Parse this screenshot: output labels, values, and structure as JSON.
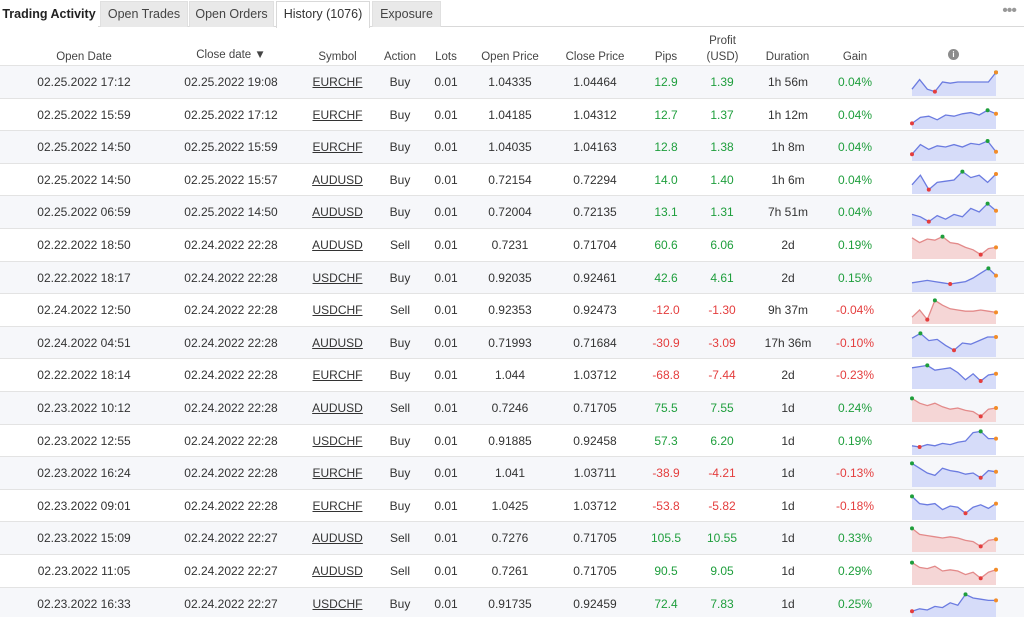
{
  "tabs": [
    {
      "label": "Trading Activity"
    },
    {
      "label": "Open Trades"
    },
    {
      "label": "Open Orders"
    },
    {
      "label": "History (1076)"
    },
    {
      "label": "Exposure"
    }
  ],
  "more_label": "•••",
  "columns": {
    "open_date": "Open Date",
    "close_date": "Close date ▼",
    "symbol": "Symbol",
    "action": "Action",
    "lots": "Lots",
    "open_price": "Open Price",
    "close_price": "Close Price",
    "pips": "Pips",
    "profit_line1": "Profit",
    "profit_line2": "(USD)",
    "duration": "Duration",
    "gain": "Gain",
    "info_icon": "i"
  },
  "colors": {
    "positive": "#1e9e3c",
    "negative": "#e43d3d",
    "spark_blue": "#6b7be0",
    "spark_red": "#e38a8a"
  },
  "rows": [
    {
      "open": "02.25.2022 17:12",
      "close": "02.25.2022 19:08",
      "symbol": "EURCHF",
      "action": "Buy",
      "lots": "0.01",
      "open_price": "1.04335",
      "close_price": "1.04464",
      "pips": "12.9",
      "profit": "1.39",
      "duration": "1h 56m",
      "gain": "0.04%",
      "positive": true
    },
    {
      "open": "02.25.2022 15:59",
      "close": "02.25.2022 17:12",
      "symbol": "EURCHF",
      "action": "Buy",
      "lots": "0.01",
      "open_price": "1.04185",
      "close_price": "1.04312",
      "pips": "12.7",
      "profit": "1.37",
      "duration": "1h 12m",
      "gain": "0.04%",
      "positive": true
    },
    {
      "open": "02.25.2022 14:50",
      "close": "02.25.2022 15:59",
      "symbol": "EURCHF",
      "action": "Buy",
      "lots": "0.01",
      "open_price": "1.04035",
      "close_price": "1.04163",
      "pips": "12.8",
      "profit": "1.38",
      "duration": "1h 8m",
      "gain": "0.04%",
      "positive": true
    },
    {
      "open": "02.25.2022 14:50",
      "close": "02.25.2022 15:57",
      "symbol": "AUDUSD",
      "action": "Buy",
      "lots": "0.01",
      "open_price": "0.72154",
      "close_price": "0.72294",
      "pips": "14.0",
      "profit": "1.40",
      "duration": "1h 6m",
      "gain": "0.04%",
      "positive": true
    },
    {
      "open": "02.25.2022 06:59",
      "close": "02.25.2022 14:50",
      "symbol": "AUDUSD",
      "action": "Buy",
      "lots": "0.01",
      "open_price": "0.72004",
      "close_price": "0.72135",
      "pips": "13.1",
      "profit": "1.31",
      "duration": "7h 51m",
      "gain": "0.04%",
      "positive": true
    },
    {
      "open": "02.22.2022 18:50",
      "close": "02.24.2022 22:28",
      "symbol": "AUDUSD",
      "action": "Sell",
      "lots": "0.01",
      "open_price": "0.7231",
      "close_price": "0.71704",
      "pips": "60.6",
      "profit": "6.06",
      "duration": "2d",
      "gain": "0.19%",
      "positive": true
    },
    {
      "open": "02.22.2022 18:17",
      "close": "02.24.2022 22:28",
      "symbol": "USDCHF",
      "action": "Buy",
      "lots": "0.01",
      "open_price": "0.92035",
      "close_price": "0.92461",
      "pips": "42.6",
      "profit": "4.61",
      "duration": "2d",
      "gain": "0.15%",
      "positive": true
    },
    {
      "open": "02.24.2022 12:50",
      "close": "02.24.2022 22:28",
      "symbol": "USDCHF",
      "action": "Sell",
      "lots": "0.01",
      "open_price": "0.92353",
      "close_price": "0.92473",
      "pips": "-12.0",
      "profit": "-1.30",
      "duration": "9h 37m",
      "gain": "-0.04%",
      "positive": false
    },
    {
      "open": "02.24.2022 04:51",
      "close": "02.24.2022 22:28",
      "symbol": "AUDUSD",
      "action": "Buy",
      "lots": "0.01",
      "open_price": "0.71993",
      "close_price": "0.71684",
      "pips": "-30.9",
      "profit": "-3.09",
      "duration": "17h 36m",
      "gain": "-0.10%",
      "positive": false
    },
    {
      "open": "02.22.2022 18:14",
      "close": "02.24.2022 22:28",
      "symbol": "EURCHF",
      "action": "Buy",
      "lots": "0.01",
      "open_price": "1.044",
      "close_price": "1.03712",
      "pips": "-68.8",
      "profit": "-7.44",
      "duration": "2d",
      "gain": "-0.23%",
      "positive": false
    },
    {
      "open": "02.23.2022 10:12",
      "close": "02.24.2022 22:28",
      "symbol": "AUDUSD",
      "action": "Sell",
      "lots": "0.01",
      "open_price": "0.7246",
      "close_price": "0.71705",
      "pips": "75.5",
      "profit": "7.55",
      "duration": "1d",
      "gain": "0.24%",
      "positive": true
    },
    {
      "open": "02.23.2022 12:55",
      "close": "02.24.2022 22:28",
      "symbol": "USDCHF",
      "action": "Buy",
      "lots": "0.01",
      "open_price": "0.91885",
      "close_price": "0.92458",
      "pips": "57.3",
      "profit": "6.20",
      "duration": "1d",
      "gain": "0.19%",
      "positive": true
    },
    {
      "open": "02.23.2022 16:24",
      "close": "02.24.2022 22:28",
      "symbol": "EURCHF",
      "action": "Buy",
      "lots": "0.01",
      "open_price": "1.041",
      "close_price": "1.03711",
      "pips": "-38.9",
      "profit": "-4.21",
      "duration": "1d",
      "gain": "-0.13%",
      "positive": false
    },
    {
      "open": "02.23.2022 09:01",
      "close": "02.24.2022 22:28",
      "symbol": "EURCHF",
      "action": "Buy",
      "lots": "0.01",
      "open_price": "1.0425",
      "close_price": "1.03712",
      "pips": "-53.8",
      "profit": "-5.82",
      "duration": "1d",
      "gain": "-0.18%",
      "positive": false
    },
    {
      "open": "02.23.2022 15:09",
      "close": "02.24.2022 22:27",
      "symbol": "AUDUSD",
      "action": "Sell",
      "lots": "0.01",
      "open_price": "0.7276",
      "close_price": "0.71705",
      "pips": "105.5",
      "profit": "10.55",
      "duration": "1d",
      "gain": "0.33%",
      "positive": true
    },
    {
      "open": "02.23.2022 11:05",
      "close": "02.24.2022 22:27",
      "symbol": "AUDUSD",
      "action": "Sell",
      "lots": "0.01",
      "open_price": "0.7261",
      "close_price": "0.71705",
      "pips": "90.5",
      "profit": "9.05",
      "duration": "1d",
      "gain": "0.29%",
      "positive": true
    },
    {
      "open": "02.23.2022 16:33",
      "close": "02.24.2022 22:27",
      "symbol": "USDCHF",
      "action": "Buy",
      "lots": "0.01",
      "open_price": "0.91735",
      "close_price": "0.92459",
      "pips": "72.4",
      "profit": "7.83",
      "duration": "1d",
      "gain": "0.25%",
      "positive": true
    }
  ],
  "sparklines": [
    {
      "color": "blue",
      "values": [
        0.2,
        0.6,
        0.2,
        0.1,
        0.5,
        0.45,
        0.5,
        0.5,
        0.5,
        0.5,
        0.5,
        0.9
      ],
      "low": 3,
      "high": 11,
      "end": 11
    },
    {
      "color": "blue",
      "values": [
        0.15,
        0.4,
        0.45,
        0.3,
        0.5,
        0.45,
        0.55,
        0.6,
        0.5,
        0.7,
        0.55
      ],
      "low": 0,
      "high": 9,
      "end": 10
    },
    {
      "color": "blue",
      "values": [
        0.2,
        0.6,
        0.4,
        0.55,
        0.5,
        0.6,
        0.5,
        0.65,
        0.6,
        0.75,
        0.3
      ],
      "low": 0,
      "high": 9,
      "end": 10
    },
    {
      "color": "blue",
      "values": [
        0.3,
        0.7,
        0.1,
        0.4,
        0.45,
        0.5,
        0.85,
        0.6,
        0.7,
        0.4,
        0.75
      ],
      "low": 2,
      "high": 6,
      "end": 10
    },
    {
      "color": "blue",
      "values": [
        0.4,
        0.3,
        0.1,
        0.35,
        0.2,
        0.4,
        0.3,
        0.65,
        0.5,
        0.85,
        0.55
      ],
      "low": 2,
      "high": 9,
      "end": 10
    },
    {
      "color": "red",
      "values": [
        0.8,
        0.6,
        0.75,
        0.7,
        0.85,
        0.6,
        0.55,
        0.4,
        0.3,
        0.1,
        0.35,
        0.4
      ],
      "low": 9,
      "high": 4,
      "end": 11
    },
    {
      "color": "blue",
      "values": [
        0.3,
        0.35,
        0.4,
        0.35,
        0.3,
        0.25,
        0.3,
        0.35,
        0.5,
        0.7,
        0.9,
        0.6
      ],
      "low": 5,
      "high": 10,
      "end": 11
    },
    {
      "color": "red",
      "values": [
        0.2,
        0.5,
        0.1,
        0.9,
        0.7,
        0.55,
        0.5,
        0.45,
        0.45,
        0.5,
        0.45,
        0.4
      ],
      "low": 2,
      "high": 3,
      "end": 11
    },
    {
      "color": "blue",
      "values": [
        0.7,
        0.9,
        0.6,
        0.65,
        0.4,
        0.2,
        0.5,
        0.45,
        0.6,
        0.75,
        0.75
      ],
      "low": 5,
      "high": 1,
      "end": 10
    },
    {
      "color": "blue",
      "values": [
        0.8,
        0.85,
        0.9,
        0.7,
        0.75,
        0.8,
        0.6,
        0.3,
        0.55,
        0.25,
        0.5,
        0.55
      ],
      "low": 9,
      "high": 2,
      "end": 11
    },
    {
      "color": "red",
      "values": [
        0.9,
        0.7,
        0.6,
        0.7,
        0.55,
        0.45,
        0.5,
        0.4,
        0.35,
        0.15,
        0.45,
        0.5
      ],
      "low": 9,
      "high": 0,
      "end": 11
    },
    {
      "color": "blue",
      "values": [
        0.3,
        0.25,
        0.35,
        0.3,
        0.4,
        0.35,
        0.45,
        0.5,
        0.85,
        0.9,
        0.6,
        0.6
      ],
      "low": 1,
      "high": 9,
      "end": 11
    },
    {
      "color": "blue",
      "values": [
        0.9,
        0.7,
        0.5,
        0.4,
        0.7,
        0.6,
        0.55,
        0.45,
        0.5,
        0.3,
        0.6,
        0.55
      ],
      "low": 9,
      "high": 0,
      "end": 11
    },
    {
      "color": "blue",
      "values": [
        0.9,
        0.6,
        0.55,
        0.6,
        0.35,
        0.5,
        0.45,
        0.2,
        0.45,
        0.55,
        0.4,
        0.6
      ],
      "low": 7,
      "high": 0,
      "end": 11
    },
    {
      "color": "red",
      "values": [
        0.9,
        0.65,
        0.6,
        0.55,
        0.5,
        0.55,
        0.5,
        0.4,
        0.35,
        0.15,
        0.4,
        0.45
      ],
      "low": 9,
      "high": 0,
      "end": 11
    },
    {
      "color": "red",
      "values": [
        0.85,
        0.65,
        0.6,
        0.7,
        0.5,
        0.55,
        0.5,
        0.35,
        0.45,
        0.2,
        0.45,
        0.55
      ],
      "low": 9,
      "high": 0,
      "end": 11
    },
    {
      "color": "blue",
      "values": [
        0.2,
        0.3,
        0.25,
        0.4,
        0.35,
        0.55,
        0.45,
        0.9,
        0.75,
        0.7,
        0.65,
        0.65
      ],
      "low": 0,
      "high": 7,
      "end": 11
    }
  ]
}
